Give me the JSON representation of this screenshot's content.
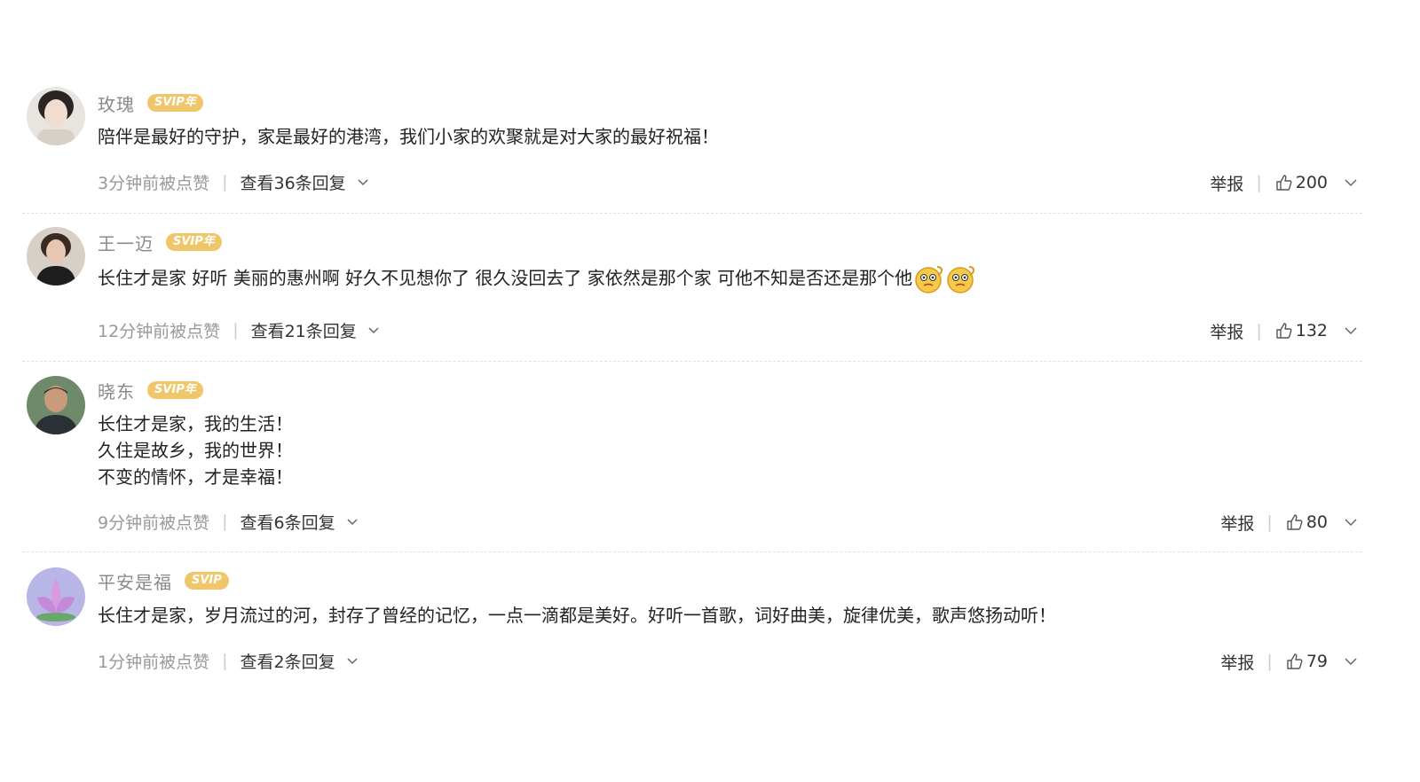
{
  "comments": [
    {
      "username": "玫瑰",
      "badge": "SVIP年",
      "text": "陪伴是最好的守护，家是最好的港湾，我们小家的欢聚就是对大家的最好祝福！",
      "time": "3分钟前被点赞",
      "replies": "查看36条回复",
      "report": "举报",
      "likes": "200"
    },
    {
      "username": "王一迈",
      "badge": "SVIP年",
      "text": "长住才是家 好听 美丽的惠州啊 好久不见想你了 很久没回去了 家依然是那个家 可他不知是否还是那个他",
      "time": "12分钟前被点赞",
      "replies": "查看21条回复",
      "report": "举报",
      "likes": "132"
    },
    {
      "username": "晓东",
      "badge": "SVIP年",
      "text": "长住才是家，我的生活！\n久住是故乡，我的世界！\n不变的情怀，才是幸福！",
      "time": "9分钟前被点赞",
      "replies": "查看6条回复",
      "report": "举报",
      "likes": "80"
    },
    {
      "username": "平安是福",
      "badge": "SVIP",
      "text": "长住才是家，岁月流过的河，封存了曾经的记忆，一点一滴都是美好。好听一首歌，词好曲美，旋律优美，歌声悠扬动听！",
      "time": "1分钟前被点赞",
      "replies": "查看2条回复",
      "report": "举报",
      "likes": "79"
    }
  ],
  "icons": {
    "like": "thumbs-up-icon",
    "expand": "chevron-down-icon",
    "emoji": "confused-face-emoji"
  },
  "colors": {
    "badge": "#f0c66a",
    "username": "#8a8a8a",
    "text": "#222222",
    "meta": "#999999"
  }
}
